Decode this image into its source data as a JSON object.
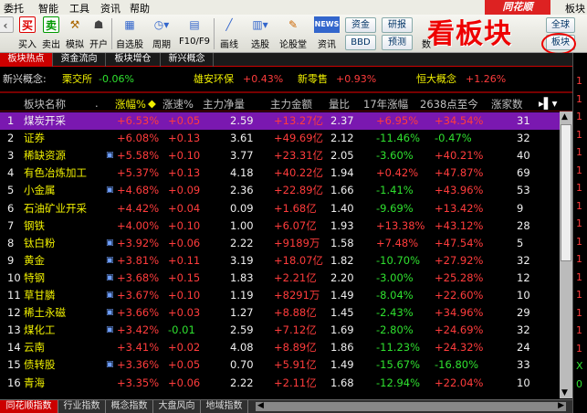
{
  "menu": {
    "items": [
      "委托",
      "智能",
      "工具",
      "资讯",
      "帮助"
    ],
    "brand": "同花顺",
    "window_title": "板块"
  },
  "toolbar": {
    "buttons": [
      "买入",
      "卖出",
      "模拟",
      "开户",
      "自选股",
      "周期",
      "F10/F9",
      "画线",
      "选股",
      "论股堂",
      "资讯"
    ],
    "small_buttons": [
      "资金",
      "研报",
      "BBD",
      "预测",
      "全球",
      "板块"
    ],
    "numbers_fragment": "数",
    "overlay_text": "看板块"
  },
  "tabs": [
    "板块热点",
    "资金流向",
    "板块增仓",
    "新兴概念"
  ],
  "concepts": {
    "label": "新兴概念:",
    "items": [
      {
        "name": "栗交所",
        "change": "-0.06%"
      },
      {
        "name": "雄安环保",
        "change": "+0.43%"
      },
      {
        "name": "新零售",
        "change": "+0.93%"
      },
      {
        "name": "恒大概念",
        "change": "+1.26%"
      }
    ]
  },
  "table": {
    "headers": [
      "板块名称",
      ".",
      "涨幅%",
      "涨速%",
      "主力净量",
      "主力金额",
      "量比",
      "17年涨幅",
      "2638点至今",
      "涨家数"
    ],
    "sort_marker": "◆",
    "rows": [
      {
        "n": "1",
        "name": "煤炭开采",
        "mark": "",
        "chg": "+6.53%",
        "spd": "+0.05",
        "net": "2.59",
        "amt": "+13.27亿",
        "vr": "2.37",
        "y17": "+6.95%",
        "since": "+34.54%",
        "up": "31"
      },
      {
        "n": "2",
        "name": "证券",
        "mark": "",
        "chg": "+6.08%",
        "spd": "+0.13",
        "net": "3.61",
        "amt": "+49.69亿",
        "vr": "2.12",
        "y17": "-11.46%",
        "since": "-0.47%",
        "up": "32"
      },
      {
        "n": "3",
        "name": "稀缺资源",
        "mark": "▣",
        "chg": "+5.58%",
        "spd": "+0.10",
        "net": "3.77",
        "amt": "+23.31亿",
        "vr": "2.05",
        "y17": "-3.60%",
        "since": "+40.21%",
        "up": "40"
      },
      {
        "n": "4",
        "name": "有色冶炼加工",
        "mark": "",
        "chg": "+5.37%",
        "spd": "+0.13",
        "net": "4.18",
        "amt": "+40.22亿",
        "vr": "1.94",
        "y17": "+0.42%",
        "since": "+47.87%",
        "up": "69"
      },
      {
        "n": "5",
        "name": "小金属",
        "mark": "▣",
        "chg": "+4.68%",
        "spd": "+0.09",
        "net": "2.36",
        "amt": "+22.89亿",
        "vr": "1.66",
        "y17": "-1.41%",
        "since": "+43.96%",
        "up": "53"
      },
      {
        "n": "6",
        "name": "石油矿业开采",
        "mark": "",
        "chg": "+4.42%",
        "spd": "+0.04",
        "net": "0.09",
        "amt": "+1.68亿",
        "vr": "1.40",
        "y17": "-9.69%",
        "since": "+13.42%",
        "up": "9"
      },
      {
        "n": "7",
        "name": "钢铁",
        "mark": "",
        "chg": "+4.00%",
        "spd": "+0.10",
        "net": "1.00",
        "amt": "+6.07亿",
        "vr": "1.93",
        "y17": "+13.38%",
        "since": "+43.12%",
        "up": "28"
      },
      {
        "n": "8",
        "name": "钛白粉",
        "mark": "▣",
        "chg": "+3.92%",
        "spd": "+0.06",
        "net": "2.22",
        "amt": "+9189万",
        "vr": "1.58",
        "y17": "+7.48%",
        "since": "+47.54%",
        "up": "5"
      },
      {
        "n": "9",
        "name": "黄金",
        "mark": "▣",
        "chg": "+3.81%",
        "spd": "+0.11",
        "net": "3.19",
        "amt": "+18.07亿",
        "vr": "1.82",
        "y17": "-10.70%",
        "since": "+27.92%",
        "up": "32"
      },
      {
        "n": "10",
        "name": "特钢",
        "mark": "▣",
        "chg": "+3.68%",
        "spd": "+0.15",
        "net": "1.83",
        "amt": "+2.21亿",
        "vr": "2.20",
        "y17": "-3.00%",
        "since": "+25.28%",
        "up": "12"
      },
      {
        "n": "11",
        "name": "草甘膦",
        "mark": "▣",
        "chg": "+3.67%",
        "spd": "+0.10",
        "net": "1.19",
        "amt": "+8291万",
        "vr": "1.49",
        "y17": "-8.04%",
        "since": "+22.60%",
        "up": "10"
      },
      {
        "n": "12",
        "name": "稀土永磁",
        "mark": "▣",
        "chg": "+3.66%",
        "spd": "+0.03",
        "net": "1.27",
        "amt": "+8.88亿",
        "vr": "1.45",
        "y17": "-2.43%",
        "since": "+34.96%",
        "up": "29"
      },
      {
        "n": "13",
        "name": "煤化工",
        "mark": "▣",
        "chg": "+3.42%",
        "spd": "-0.01",
        "net": "2.59",
        "amt": "+7.12亿",
        "vr": "1.69",
        "y17": "-2.80%",
        "since": "+24.69%",
        "up": "32"
      },
      {
        "n": "14",
        "name": "云南",
        "mark": "",
        "chg": "+3.41%",
        "spd": "+0.02",
        "net": "4.08",
        "amt": "+8.89亿",
        "vr": "1.86",
        "y17": "-11.23%",
        "since": "+24.32%",
        "up": "24"
      },
      {
        "n": "15",
        "name": "债转股",
        "mark": "▣",
        "chg": "+3.36%",
        "spd": "+0.05",
        "net": "0.70",
        "amt": "+5.91亿",
        "vr": "1.49",
        "y17": "-15.67%",
        "since": "-16.80%",
        "up": "33"
      },
      {
        "n": "16",
        "name": "青海",
        "mark": "",
        "chg": "+3.35%",
        "spd": "+0.06",
        "net": "2.22",
        "amt": "+2.11亿",
        "vr": "1.68",
        "y17": "-12.94%",
        "since": "+22.04%",
        "up": "10"
      }
    ]
  },
  "bottom_tabs": [
    "同花顺指数",
    "行业指数",
    "概念指数",
    "大盘风向",
    "地域指数"
  ],
  "right_panel_chars": [
    "1",
    "1",
    "1",
    "1",
    "1",
    "1",
    "1",
    "1",
    "1",
    "1",
    "1",
    "1",
    "1",
    "1",
    "1",
    "1",
    "X",
    "0"
  ],
  "colors": {
    "up": "#ff3c3c",
    "down": "#2fe02f",
    "selected_row": "#7a18b0",
    "brand_red": "#d22"
  }
}
